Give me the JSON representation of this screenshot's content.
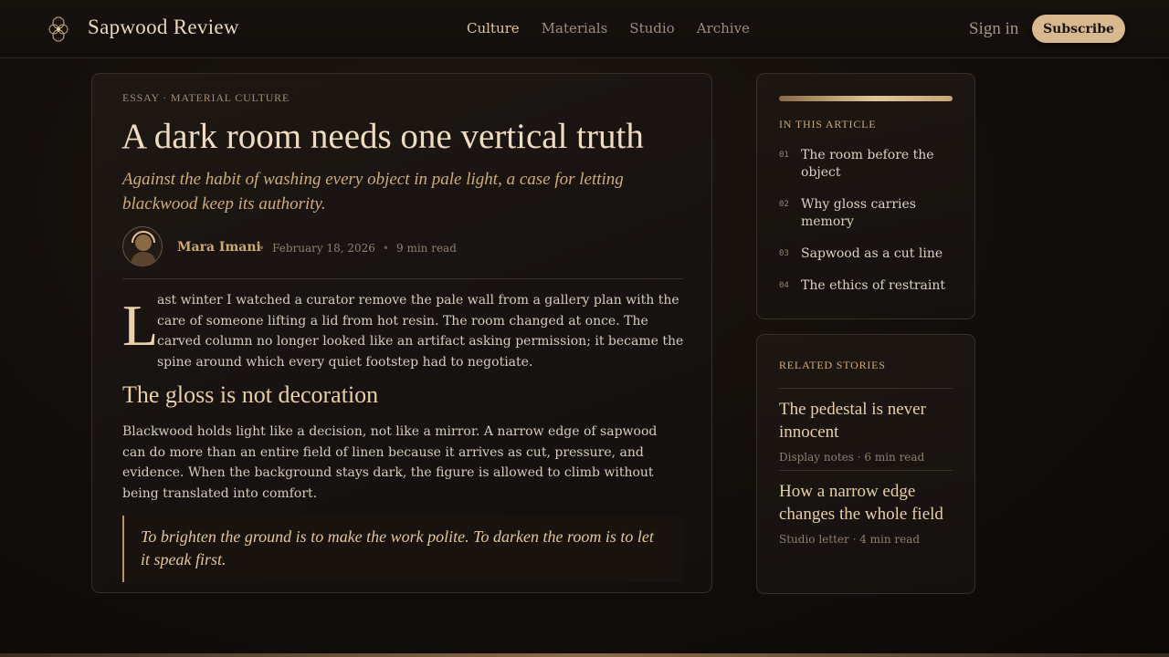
{
  "header": {
    "brand": "Sapwood Review",
    "nav": [
      {
        "label": "Culture",
        "active": true
      },
      {
        "label": "Materials",
        "active": false
      },
      {
        "label": "Studio",
        "active": false
      },
      {
        "label": "Archive",
        "active": false
      }
    ],
    "sign_in": "Sign in",
    "subscribe": "Subscribe"
  },
  "article": {
    "kicker": "ESSAY · MATERIAL CULTURE",
    "title": "A dark room needs one vertical truth",
    "dek": "Against the habit of washing every object in pale light, a case for letting blackwood keep its authority.",
    "author": "Mara Imani",
    "date": "February 18, 2026",
    "read_time": "9 min read",
    "drop_cap": "L",
    "para1": "ast winter I watched a curator remove the pale wall from a gallery plan with the care of someone lifting a lid from hot resin. The room changed at once. The carved column no longer looked like an artifact asking permission; it became the spine around which every quiet footstep had to negotiate.",
    "heading": "The gloss is not decoration",
    "para2": "Blackwood holds light like a decision, not like a mirror. A narrow edge of sapwood can do more than an entire field of linen because it arrives as cut, pressure, and evidence. When the background stays dark, the figure is allowed to climb without being translated into comfort.",
    "quote": "To brighten the ground is to make the work polite. To darken the room is to let it speak first."
  },
  "toc": {
    "heading": "IN THIS ARTICLE",
    "reading_progress": 1.0,
    "items": [
      {
        "num": "01",
        "label": "The room before the object"
      },
      {
        "num": "02",
        "label": "Why gloss carries memory"
      },
      {
        "num": "03",
        "label": "Sapwood as a cut line"
      },
      {
        "num": "04",
        "label": "The ethics of restraint"
      }
    ]
  },
  "related": {
    "heading": "RELATED STORIES",
    "items": [
      {
        "title": "The pedestal is never innocent",
        "meta": "Display notes · 6 min read"
      },
      {
        "title": "How a narrow edge changes the whole field",
        "meta": "Studio letter · 4 min read"
      }
    ]
  },
  "colors": {
    "accent": "#d8b98f",
    "background": "#110d0a",
    "card": "#1a1511",
    "heading_text": "#efdcc0",
    "body_text": "#d8ccbb"
  },
  "icons": {
    "logo": "knot-logo-icon",
    "avatar": "author-avatar"
  }
}
